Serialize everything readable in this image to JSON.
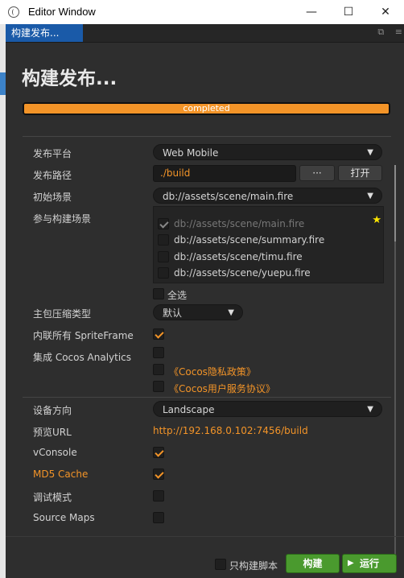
{
  "window": {
    "title": "Editor Window",
    "minimize": "—",
    "maximize": "☐",
    "close": "✕"
  },
  "tab": {
    "label": "构建发布...",
    "icon_popout": "⧉",
    "icon_menu": "≡"
  },
  "page": {
    "title": "构建发布..."
  },
  "progress": {
    "text": "completed",
    "percent": 100
  },
  "form": {
    "platform": {
      "label": "发布平台",
      "value": "Web Mobile"
    },
    "path": {
      "label": "发布路径",
      "value": "./build",
      "browse_label": "···",
      "open_label": "打开"
    },
    "start_scene": {
      "label": "初始场景",
      "value": "db://assets/scene/main.fire"
    },
    "scenes": {
      "label": "参与构建场景",
      "items": [
        {
          "path": "db://assets/scene/main.fire",
          "checked": true,
          "disabled": true
        },
        {
          "path": "db://assets/scene/summary.fire",
          "checked": false,
          "disabled": false
        },
        {
          "path": "db://assets/scene/timu.fire",
          "checked": false,
          "disabled": false
        },
        {
          "path": "db://assets/scene/yuepu.fire",
          "checked": false,
          "disabled": false
        }
      ],
      "select_all_label": "全选"
    },
    "compression": {
      "label": "主包压缩类型",
      "value": "默认"
    },
    "inline_sprite": {
      "label": "内联所有 SpriteFrame",
      "checked": true
    },
    "analytics": {
      "label": "集成 Cocos Analytics",
      "checked": false,
      "privacy_link": "《Cocos隐私政策》",
      "service_link": "《Cocos用户服务协议》"
    },
    "orientation": {
      "label": "设备方向",
      "value": "Landscape"
    },
    "preview_url": {
      "label": "预览URL",
      "value": "http://192.168.0.102:7456/build"
    },
    "vconsole": {
      "label": "vConsole",
      "checked": true
    },
    "md5_cache": {
      "label": "MD5 Cache",
      "checked": true
    },
    "debug": {
      "label": "调试模式",
      "checked": false
    },
    "source_maps": {
      "label": "Source Maps",
      "checked": false
    }
  },
  "footer": {
    "build_script_only": "只构建脚本",
    "build": "构建",
    "run": "运行",
    "run_icon": "▶"
  },
  "colors": {
    "accent": "#f39428",
    "tab_blue": "#1a5aa8",
    "button_green": "#4a9a2e",
    "panel_bg": "#2e2e2e"
  }
}
